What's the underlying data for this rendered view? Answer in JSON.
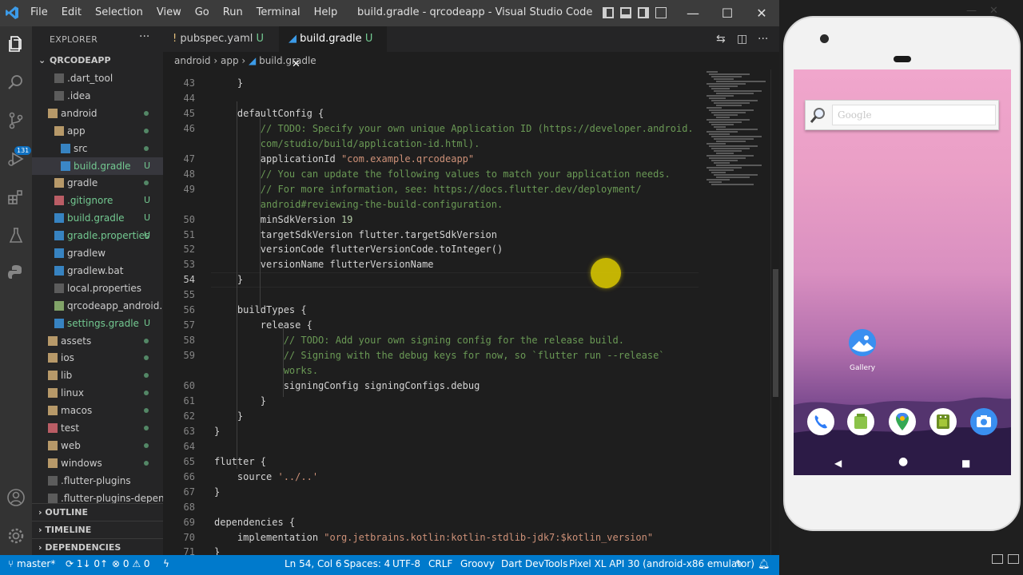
{
  "titlebar": {
    "menus": [
      "File",
      "Edit",
      "Selection",
      "View",
      "Go",
      "Run",
      "Terminal",
      "Help"
    ],
    "title": "build.gradle - qrcodeapp - Visual Studio Code"
  },
  "explorer": {
    "header": "EXPLORER",
    "root": "QRCODEAPP",
    "items": [
      {
        "label": ".dart_tool",
        "status": ""
      },
      {
        "label": ".idea",
        "status": ""
      },
      {
        "label": "android",
        "status": "dot"
      },
      {
        "label": "app",
        "status": "dot"
      },
      {
        "label": "src",
        "status": "dot"
      },
      {
        "label": "build.gradle",
        "status": "U"
      },
      {
        "label": "gradle",
        "status": "dot"
      },
      {
        "label": ".gitignore",
        "status": "U"
      },
      {
        "label": "build.gradle",
        "status": "U"
      },
      {
        "label": "gradle.properties",
        "status": "U"
      },
      {
        "label": "gradlew",
        "status": ""
      },
      {
        "label": "gradlew.bat",
        "status": ""
      },
      {
        "label": "local.properties",
        "status": ""
      },
      {
        "label": "qrcodeapp_android.i...",
        "status": ""
      },
      {
        "label": "settings.gradle",
        "status": "U"
      },
      {
        "label": "assets",
        "status": "dot"
      },
      {
        "label": "ios",
        "status": "dot"
      },
      {
        "label": "lib",
        "status": "dot"
      },
      {
        "label": "linux",
        "status": "dot"
      },
      {
        "label": "macos",
        "status": "dot"
      },
      {
        "label": "test",
        "status": "dot"
      },
      {
        "label": "web",
        "status": "dot"
      },
      {
        "label": "windows",
        "status": "dot"
      },
      {
        "label": ".flutter-plugins",
        "status": ""
      },
      {
        "label": ".flutter-plugins-depen...",
        "status": ""
      }
    ],
    "sections": [
      "OUTLINE",
      "TIMELINE",
      "DEPENDENCIES"
    ]
  },
  "activity": {
    "scm_badge": "131"
  },
  "tabs": [
    {
      "label": "pubspec.yaml",
      "status": "U"
    },
    {
      "label": "build.gradle",
      "status": "U",
      "close": "✕"
    }
  ],
  "breadcrumb": [
    "android",
    "app",
    "build.gradle"
  ],
  "editor": {
    "lines": [
      {
        "n": "43",
        "text": "    }"
      },
      {
        "n": "44",
        "text": ""
      },
      {
        "n": "45",
        "text": "    defaultConfig {"
      },
      {
        "n": "46",
        "text": "        // TODO: Specify your own unique Application ID (https://developer.android."
      },
      {
        "n": "",
        "text": "        com/studio/build/application-id.html)."
      },
      {
        "n": "47",
        "text": "        applicationId \"com.example.qrcodeapp\""
      },
      {
        "n": "48",
        "text": "        // You can update the following values to match your application needs."
      },
      {
        "n": "49",
        "text": "        // For more information, see: https://docs.flutter.dev/deployment/"
      },
      {
        "n": "",
        "text": "        android#reviewing-the-build-configuration."
      },
      {
        "n": "50",
        "text": "        minSdkVersion 19"
      },
      {
        "n": "51",
        "text": "        targetSdkVersion flutter.targetSdkVersion"
      },
      {
        "n": "52",
        "text": "        versionCode flutterVersionCode.toInteger()"
      },
      {
        "n": "53",
        "text": "        versionName flutterVersionName"
      },
      {
        "n": "54",
        "text": "    }"
      },
      {
        "n": "55",
        "text": ""
      },
      {
        "n": "56",
        "text": "    buildTypes {"
      },
      {
        "n": "57",
        "text": "        release {"
      },
      {
        "n": "58",
        "text": "            // TODO: Add your own signing config for the release build."
      },
      {
        "n": "59",
        "text": "            // Signing with the debug keys for now, so `flutter run --release`"
      },
      {
        "n": "",
        "text": "            works."
      },
      {
        "n": "60",
        "text": "            signingConfig signingConfigs.debug"
      },
      {
        "n": "61",
        "text": "        }"
      },
      {
        "n": "62",
        "text": "    }"
      },
      {
        "n": "63",
        "text": "}"
      },
      {
        "n": "64",
        "text": ""
      },
      {
        "n": "65",
        "text": "flutter {"
      },
      {
        "n": "66",
        "text": "    source '../..'"
      },
      {
        "n": "67",
        "text": "}"
      },
      {
        "n": "68",
        "text": ""
      },
      {
        "n": "69",
        "text": "dependencies {"
      },
      {
        "n": "70",
        "text": "    implementation \"org.jetbrains.kotlin:kotlin-stdlib-jdk7:$kotlin_version\""
      },
      {
        "n": "71",
        "text": "}"
      }
    ],
    "current_line": "54"
  },
  "statusbar": {
    "branch": "master*",
    "sync": "1↓ 0↑",
    "problems": "⊗ 0 ⚠ 0",
    "position": "Ln 54, Col 6",
    "spaces": "Spaces: 4",
    "encoding": "UTF-8",
    "eol": "CRLF",
    "language": "Groovy",
    "devtools": "Dart DevTools",
    "device": "Pixel XL API 30 (android-x86 emulator)"
  },
  "emulator": {
    "search_placeholder": "Google",
    "gallery_label": "Gallery",
    "dock_icons": [
      "phone-icon",
      "messages-icon",
      "maps-icon",
      "android-icon",
      "camera-icon"
    ]
  },
  "colors": {
    "accent": "#007acc",
    "keyword": "#d4d4d4",
    "comment": "#6a9955",
    "string": "#ce9178",
    "link": "#6a9955"
  }
}
